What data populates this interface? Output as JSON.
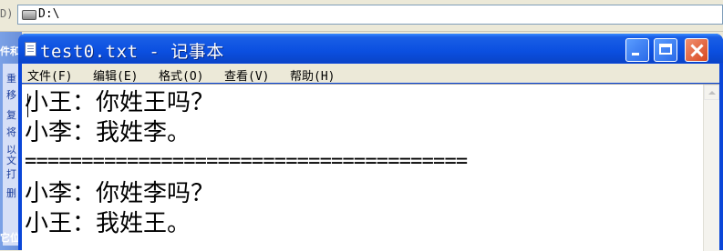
{
  "background_window": {
    "address_label_fragment": "D)",
    "address_value": "D:\\",
    "left_panel_header_fragment": "件和",
    "left_panel_items": [
      "重",
      "移",
      "复",
      "将",
      "以",
      "文",
      "打",
      "删"
    ],
    "left_panel_footer_fragment": "它位"
  },
  "notepad": {
    "title": "test0.txt - 记事本",
    "menu": [
      "文件(F)",
      "编辑(E)",
      "格式(O)",
      "查看(V)",
      "帮助(H)"
    ],
    "lines": [
      "小王：你姓王吗？",
      "小李：我姓李。",
      "=======================================",
      "小李：你姓李吗？",
      "小王：我姓王。"
    ]
  },
  "colors": {
    "title_bar": "#0b4fe0",
    "close_button": "#d84820",
    "menu_bar": "#ece9d8"
  }
}
